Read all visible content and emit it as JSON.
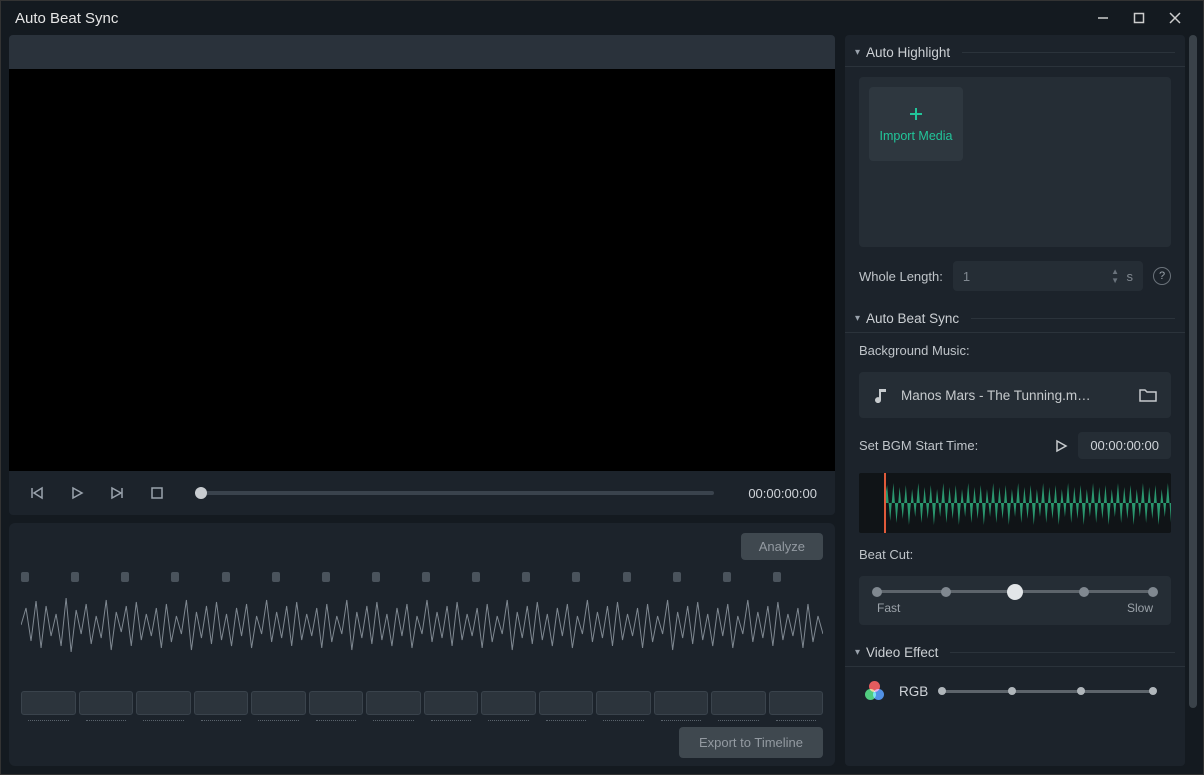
{
  "window_title": "Auto Beat Sync",
  "preview": {
    "timecode": "00:00:00:00"
  },
  "analysis": {
    "analyze_label": "Analyze",
    "export_label": "Export to Timeline"
  },
  "sidebar": {
    "auto_highlight": {
      "title": "Auto Highlight",
      "import_label": "Import Media",
      "whole_length_label": "Whole Length:",
      "whole_length_value": "1",
      "whole_length_unit": "s"
    },
    "auto_beat_sync": {
      "title": "Auto Beat Sync",
      "bg_music_label": "Background Music:",
      "track_name": "Manos Mars - The Tunning.m…",
      "start_time_label": "Set BGM Start Time:",
      "start_time_value": "00:00:00:00",
      "beat_cut_label": "Beat Cut:",
      "fast_label": "Fast",
      "slow_label": "Slow"
    },
    "video_effect": {
      "title": "Video Effect",
      "rgb_label": "RGB"
    }
  }
}
